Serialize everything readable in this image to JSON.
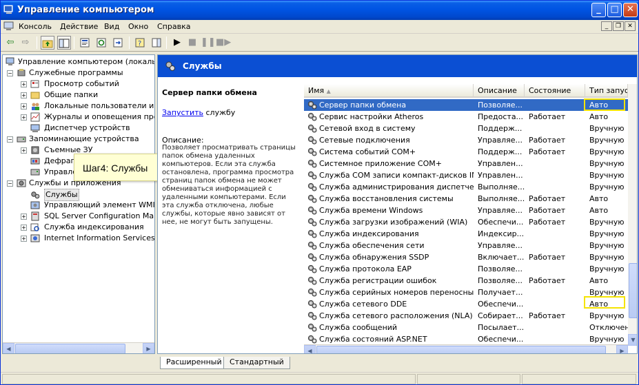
{
  "window": {
    "title": "Управление компьютером"
  },
  "menu": [
    "Консоль",
    "Действие",
    "Вид",
    "Окно",
    "Справка"
  ],
  "tree": {
    "root": "Управление компьютером (локальным)",
    "system_tools": "Служебные программы",
    "event_viewer": "Просмотр событий",
    "shared_folders": "Общие папки",
    "local_users": "Локальные пользователи и группы",
    "perf_logs": "Журналы и оповещения производительности",
    "device_manager": "Диспетчер устройств",
    "storage": "Запоминающие устройства",
    "removable": "Съемные ЗУ",
    "defrag": "Дефрагментация диска",
    "disk_mgmt": "Управление дисками",
    "services_apps": "Службы и приложения",
    "services": "Службы",
    "wmi": "Управляющий элемент WMI",
    "sql": "SQL Server Configuration Manager",
    "indexing": "Служба индексирования",
    "iis": "Internet Information Services"
  },
  "callout": "Шаг4: Службы",
  "services_header": "Службы",
  "details": {
    "title": "Сервер папки обмена",
    "start_link": "Запустить",
    "start_suffix": " службу",
    "desc_label": "Описание:",
    "desc_text": "Позволяет просматривать страницы папок обмена удаленных компьютеров. Если эта служба остановлена, программа просмотра страниц папок обмена не может обмениваться информацией с удаленными компьютерами. Если эта служба отключена, любые службы, которые явно зависят от нее, не могут быть запущены."
  },
  "columns": [
    "Имя",
    "Описание",
    "Состояние",
    "Тип запуска"
  ],
  "services": [
    {
      "name": "Сервер папки обмена",
      "desc": "Позволяе...",
      "state": "",
      "startup": "Авто"
    },
    {
      "name": "Сервис настройки Atheros",
      "desc": "Предоста...",
      "state": "Работает",
      "startup": "Авто"
    },
    {
      "name": "Сетевой вход в систему",
      "desc": "Поддерж...",
      "state": "",
      "startup": "Вручную"
    },
    {
      "name": "Сетевые подключения",
      "desc": "Управляе...",
      "state": "Работает",
      "startup": "Вручную"
    },
    {
      "name": "Система событий COM+",
      "desc": "Поддерж...",
      "state": "Работает",
      "startup": "Вручную"
    },
    {
      "name": "Системное приложение COM+",
      "desc": "Управлен...",
      "state": "",
      "startup": "Вручную"
    },
    {
      "name": "Служба COM записи компакт-дисков IMAPI",
      "desc": "Управлен...",
      "state": "",
      "startup": "Вручную"
    },
    {
      "name": "Служба администрирования диспетчера",
      "desc": "Выполняе...",
      "state": "",
      "startup": "Вручную"
    },
    {
      "name": "Служба восстановления системы",
      "desc": "Выполняе...",
      "state": "Работает",
      "startup": "Авто"
    },
    {
      "name": "Служба времени Windows",
      "desc": "Управляе...",
      "state": "Работает",
      "startup": "Авто"
    },
    {
      "name": "Служба загрузки изображений (WIA)",
      "desc": "Обеспечи...",
      "state": "Работает",
      "startup": "Вручную"
    },
    {
      "name": "Служба индексирования",
      "desc": "Индексир...",
      "state": "",
      "startup": "Вручную"
    },
    {
      "name": "Служба обеспечения сети",
      "desc": "Управляе...",
      "state": "",
      "startup": "Вручную"
    },
    {
      "name": "Служба обнаружения SSDP",
      "desc": "Включает...",
      "state": "Работает",
      "startup": "Вручную"
    },
    {
      "name": "Служба протокола EAP",
      "desc": "Позволяе...",
      "state": "",
      "startup": "Вручную"
    },
    {
      "name": "Служба регистрации ошибок",
      "desc": "Позволяе...",
      "state": "Работает",
      "startup": "Авто"
    },
    {
      "name": "Служба серийных номеров переносных у...",
      "desc": "Получает...",
      "state": "",
      "startup": "Вручную"
    },
    {
      "name": "Служба сетевого DDE",
      "desc": "Обеспечи...",
      "state": "",
      "startup": "Авто"
    },
    {
      "name": "Служба сетевого расположения (NLA)",
      "desc": "Собирает...",
      "state": "Работает",
      "startup": "Вручную"
    },
    {
      "name": "Служба сообщений",
      "desc": "Посылает...",
      "state": "",
      "startup": "Отключен"
    },
    {
      "name": "Служба состояний ASP.NET",
      "desc": "Обеспечи...",
      "state": "",
      "startup": "Вручную"
    }
  ],
  "tabs": [
    "Расширенный",
    "Стандартный"
  ],
  "colors": {
    "title_blue": "#0054e3",
    "selection": "#316ac5",
    "highlight_box": "#f5e400",
    "header_blue": "#0b4fd3"
  }
}
